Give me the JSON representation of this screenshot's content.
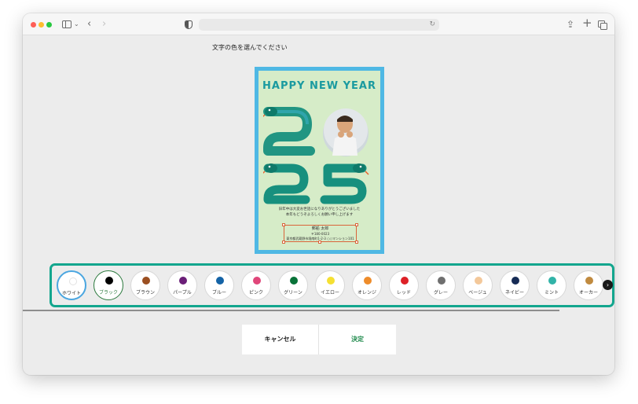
{
  "browser": {
    "address": "",
    "icons": [
      "sidebar-icon",
      "chevron-down-icon",
      "back-icon",
      "forward-icon",
      "shield-icon",
      "reload-icon",
      "share-icon",
      "new-tab-icon",
      "tabs-icon"
    ]
  },
  "page": {
    "instruction": "文字の色を選んでください"
  },
  "card": {
    "title": "HAPPY NEW YEAR",
    "year": "2025",
    "message_line1": "旧年中は大変お世話になりありがとうございました",
    "message_line2": "本年もどうぞよろしくお願い申し上げます",
    "name": "郵船 太郎",
    "postal": "〒180-0023",
    "address": "東京都武蔵野市境南町1-2-3 ○○マンション101",
    "colors": {
      "frame": "#4fb8e4",
      "background": "#d6ecc8",
      "title": "#1a9aa0",
      "snake": "#17907e"
    }
  },
  "palette": {
    "swatches": [
      {
        "label": "ホワイト",
        "color": "#ffffff",
        "state": "focused"
      },
      {
        "label": "ブラック",
        "color": "#000000",
        "state": "selected"
      },
      {
        "label": "ブラウン",
        "color": "#9b4f21"
      },
      {
        "label": "パープル",
        "color": "#6b1f78"
      },
      {
        "label": "ブルー",
        "color": "#1463a6"
      },
      {
        "label": "ピンク",
        "color": "#e0467a"
      },
      {
        "label": "グリーン",
        "color": "#087238"
      },
      {
        "label": "イエロー",
        "color": "#f5e032"
      },
      {
        "label": "オレンジ",
        "color": "#ee8c2a"
      },
      {
        "label": "レッド",
        "color": "#dd2027"
      },
      {
        "label": "グレー",
        "color": "#6f6f6f"
      },
      {
        "label": "ベージュ",
        "color": "#f3c89a"
      },
      {
        "label": "ネイビー",
        "color": "#162b55"
      },
      {
        "label": "ミント",
        "color": "#31b3a8"
      },
      {
        "label": "オーカー",
        "color": "#c08a3f"
      }
    ],
    "next_icon": "chevron-right-icon"
  },
  "actions": {
    "cancel": "キャンセル",
    "confirm": "決定"
  }
}
